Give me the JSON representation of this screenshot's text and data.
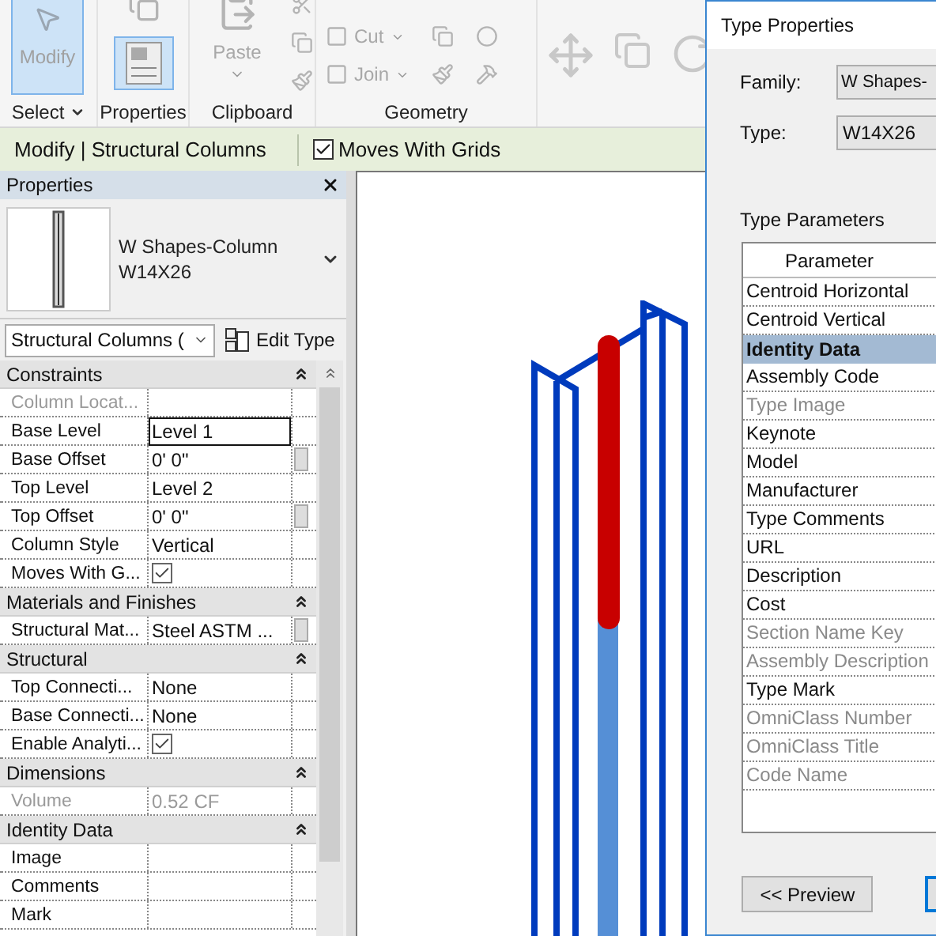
{
  "ribbon": {
    "panels": [
      {
        "kind": "select",
        "label": "Select",
        "has_menu": true,
        "buttons": [
          {
            "label": "Modify",
            "selected": true
          }
        ]
      },
      {
        "kind": "properties",
        "label": "Properties",
        "buttons": [
          {
            "selected": true
          }
        ]
      },
      {
        "kind": "clipboard",
        "label": "Clipboard",
        "buttons": [
          {
            "label": "Paste"
          }
        ]
      },
      {
        "kind": "geometry",
        "label": "Geometry",
        "buttons": [
          {
            "label": "Cut"
          },
          {
            "label": "Join"
          }
        ]
      },
      {
        "kind": "modify"
      }
    ]
  },
  "context_bar": {
    "title": "Modify | Structural Columns",
    "options": [
      {
        "label": "Moves With Grids",
        "checked": true
      }
    ]
  },
  "properties": {
    "title": "Properties",
    "type_name": "W Shapes-Column",
    "type_size": "W14X26",
    "filter": "Structural Columns (",
    "edit_type": "Edit Type",
    "rows": [
      {
        "kind": "group",
        "label": "Constraints",
        "expanded": true
      },
      {
        "kind": "text",
        "label": "Column Locat...",
        "disabled": true
      },
      {
        "kind": "text",
        "label": "Base Level",
        "value": "Level 1",
        "focused": true
      },
      {
        "kind": "text",
        "label": "Base Offset",
        "value": "0'  0\"",
        "button": true
      },
      {
        "kind": "text",
        "label": "Top Level",
        "value": "Level 2"
      },
      {
        "kind": "text",
        "label": "Top Offset",
        "value": "0'  0\"",
        "button": true
      },
      {
        "kind": "text",
        "label": "Column Style",
        "value": "Vertical"
      },
      {
        "kind": "check",
        "label": "Moves With G...",
        "checked": true
      },
      {
        "kind": "group",
        "label": "Materials and Finishes",
        "expanded": true
      },
      {
        "kind": "text",
        "label": "Structural Mat...",
        "value": "Steel ASTM ...",
        "button": true
      },
      {
        "kind": "group",
        "label": "Structural",
        "expanded": true
      },
      {
        "kind": "text",
        "label": "Top Connecti...",
        "value": "None"
      },
      {
        "kind": "text",
        "label": "Base Connecti...",
        "value": "None"
      },
      {
        "kind": "check",
        "label": "Enable Analyti...",
        "checked": true
      },
      {
        "kind": "group",
        "label": "Dimensions",
        "expanded": true
      },
      {
        "kind": "text",
        "label": "Volume",
        "value": "0.52 CF",
        "disabled": true
      },
      {
        "kind": "group",
        "label": "Identity Data",
        "expanded": true
      },
      {
        "kind": "text",
        "label": "Image"
      },
      {
        "kind": "text",
        "label": "Comments"
      },
      {
        "kind": "text",
        "label": "Mark"
      }
    ]
  },
  "type_dialog": {
    "title": "Type Properties",
    "family_label": "Family:",
    "family": "W Shapes-",
    "type_label": "Type:",
    "type": "W14X26",
    "section": "Type Parameters",
    "table": {
      "columns": [
        "Parameter"
      ],
      "rows": [
        {
          "kind": "param",
          "label": "Centroid Horizontal",
          "disabled": false
        },
        {
          "kind": "param",
          "label": "Centroid Vertical",
          "disabled": false
        },
        {
          "kind": "group",
          "label": "Identity Data",
          "selected": true
        },
        {
          "kind": "param",
          "label": "Assembly Code",
          "disabled": false
        },
        {
          "kind": "param",
          "label": "Type Image",
          "disabled": true
        },
        {
          "kind": "param",
          "label": "Keynote",
          "disabled": false
        },
        {
          "kind": "param",
          "label": "Model",
          "disabled": false
        },
        {
          "kind": "param",
          "label": "Manufacturer",
          "disabled": false
        },
        {
          "kind": "param",
          "label": "Type Comments",
          "disabled": false
        },
        {
          "kind": "param",
          "label": "URL",
          "disabled": false
        },
        {
          "kind": "param",
          "label": "Description",
          "disabled": false
        },
        {
          "kind": "param",
          "label": "Cost",
          "disabled": false
        },
        {
          "kind": "param",
          "label": "Section Name Key",
          "disabled": true
        },
        {
          "kind": "param",
          "label": "Assembly Description",
          "disabled": true
        },
        {
          "kind": "param",
          "label": "Type Mark",
          "disabled": false
        },
        {
          "kind": "param",
          "label": "OmniClass Number",
          "disabled": true
        },
        {
          "kind": "param",
          "label": "OmniClass Title",
          "disabled": true
        },
        {
          "kind": "param",
          "label": "Code Name",
          "disabled": true
        }
      ]
    },
    "buttons": [
      "<< Preview"
    ]
  }
}
